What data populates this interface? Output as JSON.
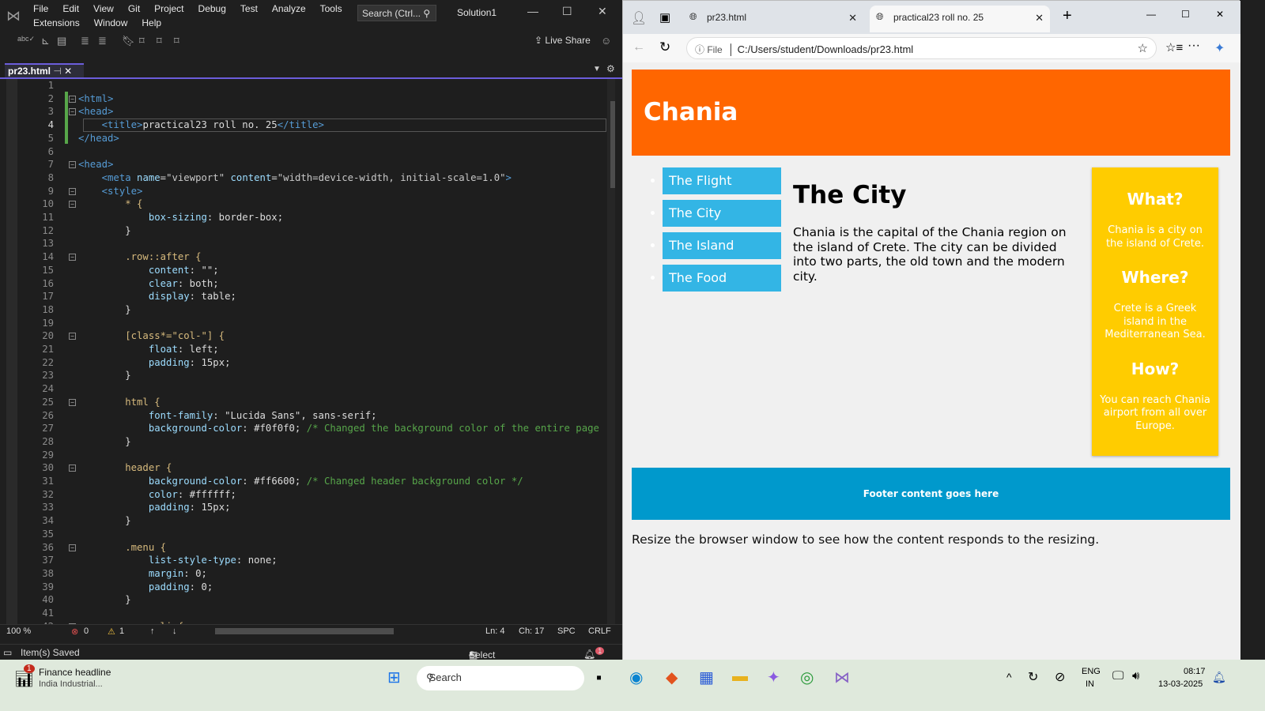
{
  "vs": {
    "menu": [
      "File",
      "Edit",
      "View",
      "Git",
      "Project",
      "Debug",
      "Test",
      "Analyze",
      "Tools",
      "Extensions",
      "Window",
      "Help"
    ],
    "search_placeholder": "Search (Ctrl...",
    "solution": "Solution1",
    "live_share": "Live Share",
    "tab": "pr23.html",
    "code": [
      [],
      [
        [
          "<html>",
          "tag"
        ]
      ],
      [
        [
          "<head>",
          "tag"
        ]
      ],
      [
        [
          "    <title>",
          "tag"
        ],
        [
          "practical23 roll no. 25",
          "txt"
        ],
        [
          "</title>",
          "tag"
        ]
      ],
      [
        [
          "</head>",
          "tag"
        ]
      ],
      [],
      [
        [
          "<head>",
          "tag"
        ]
      ],
      [
        [
          "    <meta ",
          "tag"
        ],
        [
          "name",
          "att"
        ],
        [
          "=",
          "txt"
        ],
        [
          "\"viewport\"",
          "str"
        ],
        [
          " content",
          "att"
        ],
        [
          "=",
          "txt"
        ],
        [
          "\"width=device-width, initial-scale=1.0\"",
          "str"
        ],
        [
          ">",
          "tag"
        ]
      ],
      [
        [
          "    <style>",
          "tag"
        ]
      ],
      [
        [
          "        * {",
          "sel"
        ]
      ],
      [
        [
          "            box-sizing",
          "prop"
        ],
        [
          ": border-box;",
          "txt"
        ]
      ],
      [
        [
          "        }",
          "txt"
        ]
      ],
      [],
      [
        [
          "        .row::after {",
          "sel"
        ]
      ],
      [
        [
          "            content",
          "prop"
        ],
        [
          ": \"\";",
          "txt"
        ]
      ],
      [
        [
          "            clear",
          "prop"
        ],
        [
          ": both;",
          "txt"
        ]
      ],
      [
        [
          "            display",
          "prop"
        ],
        [
          ": table;",
          "txt"
        ]
      ],
      [
        [
          "        }",
          "txt"
        ]
      ],
      [],
      [
        [
          "        [class*=\"col-\"] {",
          "sel"
        ]
      ],
      [
        [
          "            float",
          "prop"
        ],
        [
          ": left;",
          "txt"
        ]
      ],
      [
        [
          "            padding",
          "prop"
        ],
        [
          ": 15px;",
          "txt"
        ]
      ],
      [
        [
          "        }",
          "txt"
        ]
      ],
      [],
      [
        [
          "        html {",
          "sel"
        ]
      ],
      [
        [
          "            font-family",
          "prop"
        ],
        [
          ": \"Lucida Sans\", sans-serif;",
          "txt"
        ]
      ],
      [
        [
          "            background-color",
          "prop"
        ],
        [
          ": #f0f0f0; ",
          "txt"
        ],
        [
          "/* Changed the background color of the entire page",
          "cmt"
        ]
      ],
      [
        [
          "        }",
          "txt"
        ]
      ],
      [],
      [
        [
          "        header {",
          "sel"
        ]
      ],
      [
        [
          "            background-color",
          "prop"
        ],
        [
          ": #ff6600; ",
          "txt"
        ],
        [
          "/* Changed header background color */",
          "cmt"
        ]
      ],
      [
        [
          "            color",
          "prop"
        ],
        [
          ": #ffffff;",
          "txt"
        ]
      ],
      [
        [
          "            padding",
          "prop"
        ],
        [
          ": 15px;",
          "txt"
        ]
      ],
      [
        [
          "        }",
          "txt"
        ]
      ],
      [],
      [
        [
          "        .menu {",
          "sel"
        ]
      ],
      [
        [
          "            list-style-type",
          "prop"
        ],
        [
          ": none;",
          "txt"
        ]
      ],
      [
        [
          "            margin",
          "prop"
        ],
        [
          ": 0;",
          "txt"
        ]
      ],
      [
        [
          "            padding",
          "prop"
        ],
        [
          ": 0;",
          "txt"
        ]
      ],
      [
        [
          "        }",
          "txt"
        ]
      ],
      [],
      [
        [
          "        .menu li {",
          "sel"
        ]
      ]
    ],
    "folds": [
      2,
      3,
      7,
      9,
      10,
      14,
      20,
      25,
      30,
      36,
      42
    ],
    "zoom": "100 %",
    "errors": "0",
    "warnings": "1",
    "ln": "Ln: 4",
    "ch": "Ch: 17",
    "spc": "SPC",
    "crlf": "CRLF",
    "status_msg": "Item(s) Saved",
    "select_repo": "Select Repository",
    "notif_count": "1"
  },
  "browser": {
    "tabs": [
      "pr23.html",
      "practical23 roll no. 25"
    ],
    "file_label": "File",
    "url": "C:/Users/student/Downloads/pr23.html",
    "page": {
      "header": "Chania",
      "nav": [
        "The Flight",
        "The City",
        "The Island",
        "The Food"
      ],
      "main_title": "The City",
      "main_text": "Chania is the capital of the Chania region on the island of Crete. The city can be divided into two parts, the old town and the modern city.",
      "aside": [
        {
          "h": "What?",
          "p": "Chania is a city on the island of Crete."
        },
        {
          "h": "Where?",
          "p": "Crete is a Greek island in the Mediterranean Sea."
        },
        {
          "h": "How?",
          "p": "You can reach Chania airport from all over Europe."
        }
      ],
      "footer": "Footer content goes here",
      "note": "Resize the browser window to see how the content responds to the resizing.",
      "colors": {
        "header": "#ff6600",
        "nav": "#33b5e5",
        "aside": "#ffcc00",
        "footer": "#0099cc"
      }
    }
  },
  "taskbar": {
    "news_title": "Finance headline",
    "news_sub": "India Industrial...",
    "news_badge": "1",
    "search": "Search",
    "lang": "ENG",
    "lang2": "IN",
    "time": "08:17",
    "date": "13-03-2025"
  }
}
